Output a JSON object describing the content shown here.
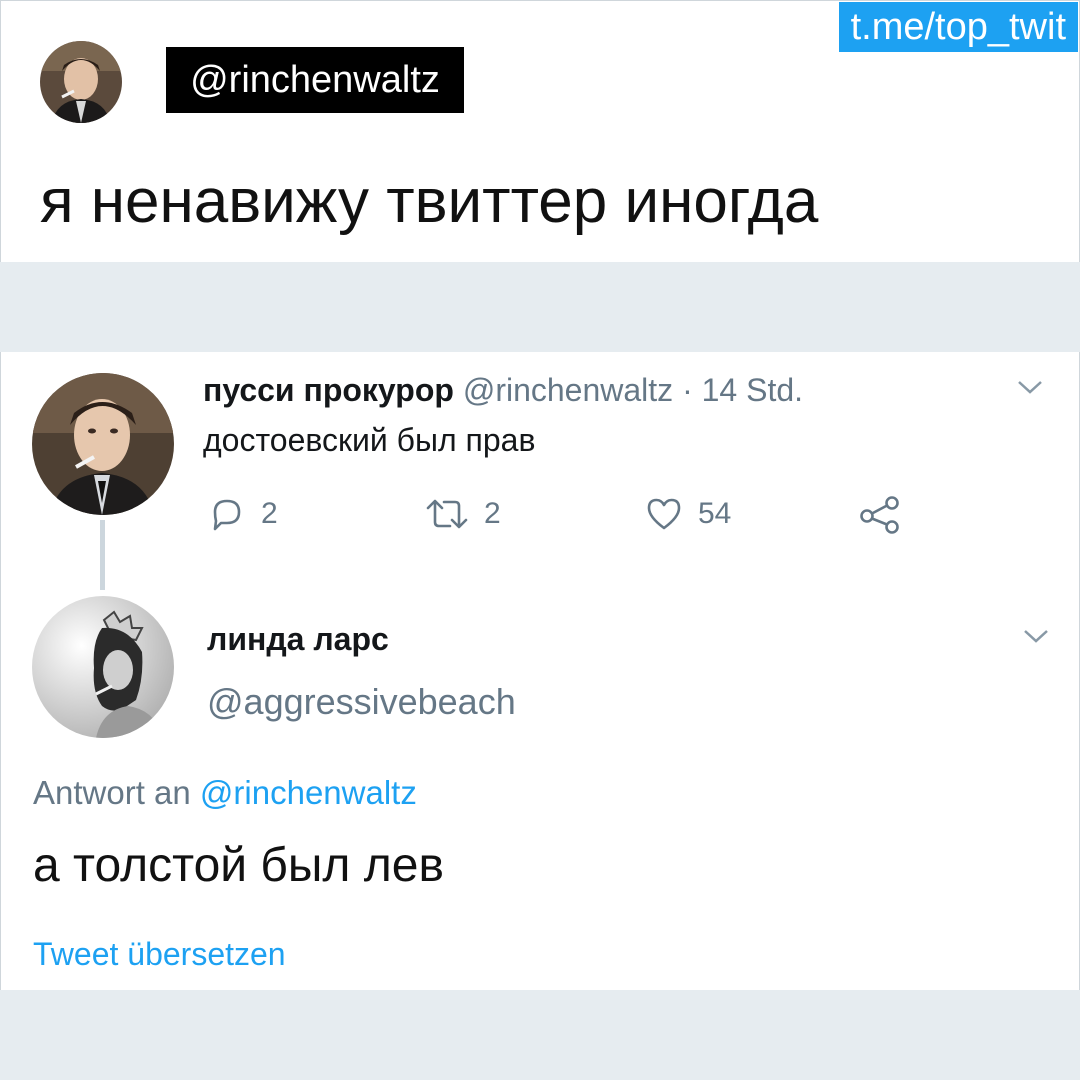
{
  "watermark": "t.me/top_twit",
  "header": {
    "handle": "@rinchenwaltz",
    "text": "я ненавижу твиттер иногда"
  },
  "tweet1": {
    "name": "пусси прокурор",
    "handle": "@rinchenwaltz",
    "separator": "·",
    "time": "14 Std.",
    "text": "достоевский был прав",
    "actions": {
      "reply_count": "2",
      "retweet_count": "2",
      "like_count": "54"
    }
  },
  "tweet2": {
    "name": "линда ларс",
    "handle": "@aggressivebeach",
    "reply_prefix": "Antwort an",
    "reply_to": "@rinchenwaltz",
    "text": "а толстой был лев",
    "translate": "Tweet übersetzen"
  },
  "colors": {
    "accent": "#1da1f2",
    "muted": "#657786",
    "band": "#e6ecf0",
    "text": "#14171a"
  },
  "icons": [
    "reply-icon",
    "retweet-icon",
    "like-icon",
    "share-icon",
    "chevron-down-icon"
  ]
}
